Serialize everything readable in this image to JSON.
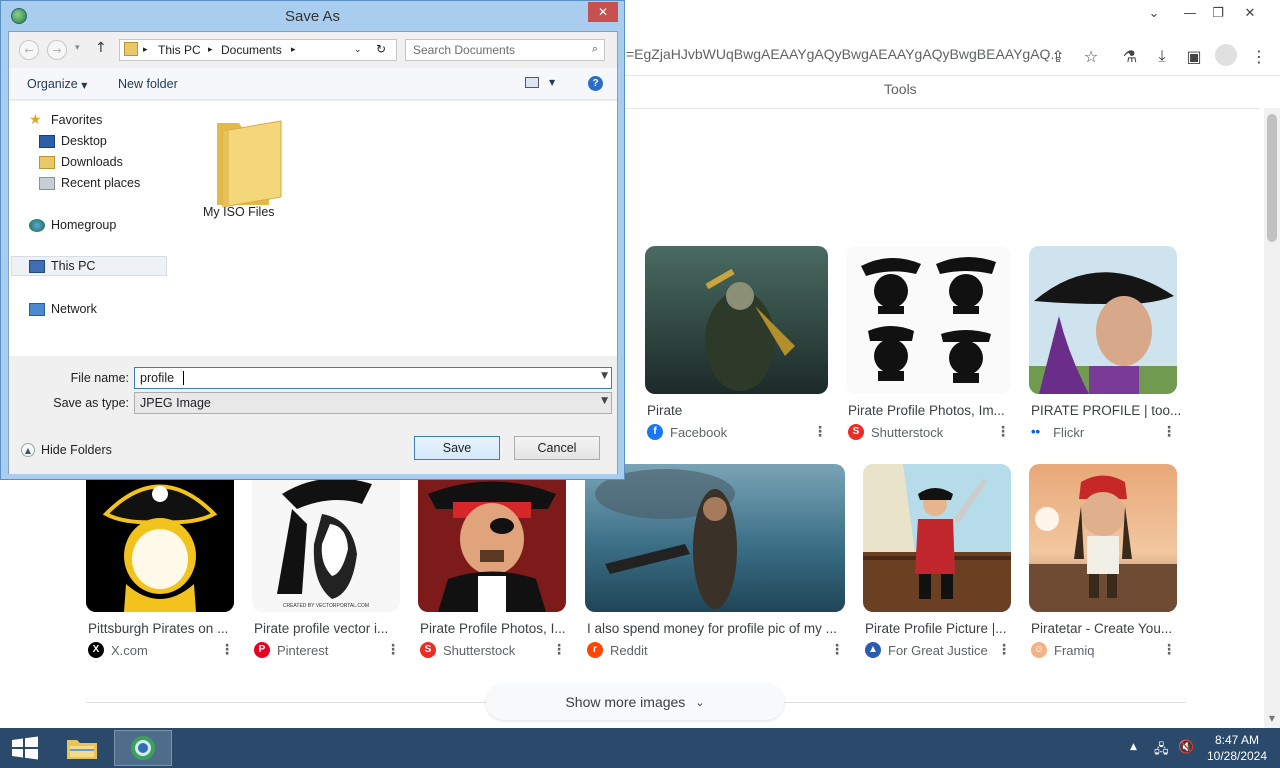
{
  "browser": {
    "url_text": "=EgZjaHJvbWUqBwgAEAAYgAQyBwgAEAAYgAQyBwgBEAAYgAQ...",
    "tools_label": "Tools",
    "show_more_label": "Show more images",
    "row1": [
      {
        "title": "Pirate",
        "source": "Facebook",
        "source_color": "#1877f2"
      },
      {
        "title": "Pirate Profile Photos, Im...",
        "source": "Shutterstock",
        "source_color": "#ee2b24"
      },
      {
        "title": "PIRATE PROFILE | too...",
        "source": "Flickr",
        "source_color": "#0063dc"
      }
    ],
    "row2": [
      {
        "title": "Pittsburgh Pirates on ...",
        "source": "X.com",
        "source_color": "#000000"
      },
      {
        "title": "Pirate profile vector i...",
        "source": "Pinterest",
        "source_color": "#e60023"
      },
      {
        "title": "Pirate Profile Photos, I...",
        "source": "Shutterstock",
        "source_color": "#ee2b24"
      },
      {
        "title": "I also spend money for profile pic of my ...",
        "source": "Reddit",
        "source_color": "#ff4500"
      },
      {
        "title": "Pirate Profile Picture |...",
        "source": "For Great Justice",
        "source_color": "#2a5db0"
      },
      {
        "title": "Piratetar - Create You...",
        "source": "Framiq",
        "source_color": "#f4b183"
      }
    ],
    "image_caption_small": "CREATED BY VECTORPORTAL.COM"
  },
  "dialog": {
    "title": "Save As",
    "breadcrumb": [
      "This PC",
      "Documents"
    ],
    "search_placeholder": "Search Documents",
    "organize_label": "Organize",
    "new_folder_label": "New folder",
    "nav": {
      "favorites": "Favorites",
      "desktop": "Desktop",
      "downloads": "Downloads",
      "recent": "Recent places",
      "homegroup": "Homegroup",
      "this_pc": "This PC",
      "network": "Network"
    },
    "folder_name": "My ISO Files",
    "file_name_label": "File name:",
    "file_name_value": "profile",
    "save_type_label": "Save as type:",
    "save_type_value": "JPEG Image",
    "hide_folders_label": "Hide Folders",
    "save_label": "Save",
    "cancel_label": "Cancel"
  },
  "taskbar": {
    "time": "8:47 AM",
    "date": "10/28/2024"
  }
}
